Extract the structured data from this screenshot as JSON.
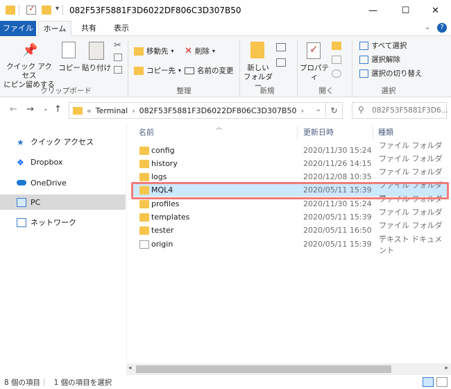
{
  "window": {
    "title": "082F53F5881F3D6022DF806C3D307B50",
    "minimize": "—",
    "maximize": "☐",
    "close": "✕"
  },
  "tabs": [
    {
      "label": "ファイル"
    },
    {
      "label": "ホーム"
    },
    {
      "label": "共有"
    },
    {
      "label": "表示"
    }
  ],
  "ribbon": {
    "clipboard": {
      "pin_label_1": "クイック アクセス",
      "pin_label_2": "にピン留めする",
      "copy": "コピー",
      "paste": "貼り付け",
      "group": "クリップボード"
    },
    "organize": {
      "move_to": "移動先",
      "copy_to": "コピー先",
      "delete": "削除",
      "rename": "名前の変更",
      "group": "整理"
    },
    "new": {
      "new_folder_1": "新しい",
      "new_folder_2": "フォルダー",
      "group": "新規"
    },
    "open": {
      "properties": "プロパティ",
      "group": "開く"
    },
    "select": {
      "select_all": "すべて選択",
      "select_none": "選択解除",
      "invert": "選択の切り替え",
      "group": "選択"
    }
  },
  "address": {
    "chevron": "«",
    "crumb1": "Terminal",
    "crumb2": "082F53F5881F3D6022DF806C3D307B50",
    "search_placeholder": "082F53F5881F3D6..."
  },
  "nav": {
    "items": [
      {
        "label": "クイック アクセス"
      },
      {
        "label": "Dropbox"
      },
      {
        "label": "OneDrive"
      },
      {
        "label": "PC"
      },
      {
        "label": "ネットワーク"
      }
    ]
  },
  "columns": {
    "name": "名前",
    "date": "更新日時",
    "type": "種類"
  },
  "files": [
    {
      "name": "config",
      "date": "2020/11/30 15:24",
      "type": "ファイル フォルダー"
    },
    {
      "name": "history",
      "date": "2020/11/26 14:15",
      "type": "ファイル フォルダー"
    },
    {
      "name": "logs",
      "date": "2020/12/08 10:35",
      "type": "ファイル フォルダー"
    },
    {
      "name": "MQL4",
      "date": "2020/05/11 15:39",
      "type": "ファイル フォルダー"
    },
    {
      "name": "profiles",
      "date": "2020/11/30 15:24",
      "type": "ファイル フォルダー"
    },
    {
      "name": "templates",
      "date": "2020/05/11 15:39",
      "type": "ファイル フォルダー"
    },
    {
      "name": "tester",
      "date": "2020/05/11 16:50",
      "type": "ファイル フォルダー"
    },
    {
      "name": "origin",
      "date": "2020/05/11 15:39",
      "type": "テキスト ドキュメント"
    }
  ],
  "status": {
    "count": "8 個の項目",
    "selected": "1 個の項目を選択"
  },
  "colors": {
    "accent": "#1a62b7",
    "selection": "#cce8ff",
    "highlight": "#ef7c7a",
    "folder": "#f7c44c"
  }
}
